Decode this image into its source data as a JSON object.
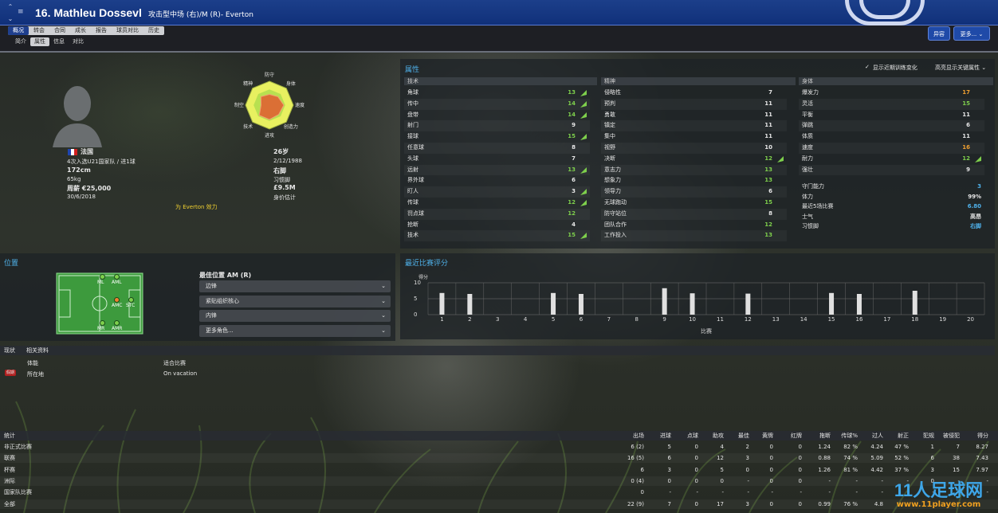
{
  "header": {
    "title": "16. Mathleu Dossevl",
    "role": "攻击型中场 (右)/M (R)- Everton",
    "nav_up": "⌃",
    "nav_down": "⌄",
    "menu_icon": "≡",
    "btn_offer": "异容",
    "btn_more": "更多..."
  },
  "tabs": [
    "概况",
    "转会",
    "合同",
    "成长",
    "报告",
    "球员对比",
    "历史"
  ],
  "subtabs": [
    "简介",
    "属性",
    "信息",
    "对比"
  ],
  "profile": {
    "nationality": "法国",
    "caps": "4次入选U21国家队 / 进1球",
    "height": "172cm",
    "weight": "65kg",
    "wage": "周薪 €25,000",
    "contract": "30/6/2018",
    "age": "26岁",
    "dob": "2/12/1988",
    "foot_val": "右脚",
    "foot_label": "习惯脚",
    "value": "£9.5M",
    "value_label": "身价估计",
    "club_note": "为 Everton 效力"
  },
  "radar": {
    "labels": [
      "防守",
      "身体",
      "速度",
      "创造力",
      "进攻",
      "技术",
      "制空",
      "精神"
    ],
    "values": [
      0.45,
      0.5,
      0.6,
      0.55,
      0.6,
      0.6,
      0.35,
      0.5
    ]
  },
  "attributes": {
    "title": "属性",
    "show_changes": "显示近期训练变化",
    "highlight": "高亮显示关键属性",
    "technical": {
      "title": "技术",
      "items": [
        {
          "n": "角球",
          "v": "13",
          "c": "g",
          "a": "up"
        },
        {
          "n": "传中",
          "v": "14",
          "c": "g",
          "a": "up"
        },
        {
          "n": "盘带",
          "v": "14",
          "c": "g",
          "a": "up"
        },
        {
          "n": "射门",
          "v": "9",
          "c": "w",
          "a": ""
        },
        {
          "n": "接球",
          "v": "15",
          "c": "g",
          "a": "up"
        },
        {
          "n": "任意球",
          "v": "8",
          "c": "w",
          "a": ""
        },
        {
          "n": "头球",
          "v": "7",
          "c": "w",
          "a": ""
        },
        {
          "n": "远射",
          "v": "13",
          "c": "g",
          "a": "up"
        },
        {
          "n": "界外球",
          "v": "6",
          "c": "w",
          "a": ""
        },
        {
          "n": "盯人",
          "v": "3",
          "c": "w",
          "a": "up"
        },
        {
          "n": "传球",
          "v": "12",
          "c": "g",
          "a": "up"
        },
        {
          "n": "罚点球",
          "v": "12",
          "c": "g",
          "a": ""
        },
        {
          "n": "抢断",
          "v": "4",
          "c": "w",
          "a": ""
        },
        {
          "n": "技术",
          "v": "15",
          "c": "g",
          "a": "up"
        }
      ]
    },
    "mental": {
      "title": "精神",
      "items": [
        {
          "n": "侵略性",
          "v": "7",
          "c": "w",
          "a": ""
        },
        {
          "n": "预判",
          "v": "11",
          "c": "w",
          "a": ""
        },
        {
          "n": "勇敢",
          "v": "11",
          "c": "w",
          "a": ""
        },
        {
          "n": "镇定",
          "v": "11",
          "c": "w",
          "a": ""
        },
        {
          "n": "集中",
          "v": "11",
          "c": "w",
          "a": ""
        },
        {
          "n": "视野",
          "v": "10",
          "c": "w",
          "a": ""
        },
        {
          "n": "决断",
          "v": "12",
          "c": "g",
          "a": "up"
        },
        {
          "n": "意志力",
          "v": "13",
          "c": "g",
          "a": ""
        },
        {
          "n": "想象力",
          "v": "13",
          "c": "g",
          "a": ""
        },
        {
          "n": "领导力",
          "v": "6",
          "c": "w",
          "a": ""
        },
        {
          "n": "无球跑动",
          "v": "15",
          "c": "g",
          "a": ""
        },
        {
          "n": "防守站位",
          "v": "8",
          "c": "w",
          "a": ""
        },
        {
          "n": "团队合作",
          "v": "12",
          "c": "g",
          "a": ""
        },
        {
          "n": "工作投入",
          "v": "13",
          "c": "g",
          "a": ""
        }
      ]
    },
    "physical": {
      "title": "身体",
      "items": [
        {
          "n": "爆发力",
          "v": "17",
          "c": "o",
          "a": ""
        },
        {
          "n": "灵活",
          "v": "15",
          "c": "g",
          "a": ""
        },
        {
          "n": "平衡",
          "v": "11",
          "c": "w",
          "a": ""
        },
        {
          "n": "弹跳",
          "v": "6",
          "c": "w",
          "a": ""
        },
        {
          "n": "体质",
          "v": "11",
          "c": "w",
          "a": ""
        },
        {
          "n": "速度",
          "v": "16",
          "c": "o",
          "a": ""
        },
        {
          "n": "耐力",
          "v": "12",
          "c": "g",
          "a": "up"
        },
        {
          "n": "强壮",
          "v": "9",
          "c": "w",
          "a": ""
        }
      ]
    },
    "extra": [
      {
        "n": "守门能力",
        "v": "3",
        "c": "b"
      },
      {
        "n": "体力",
        "v": "99%",
        "c": "w"
      },
      {
        "n": "最近5场比赛",
        "v": "6.80",
        "c": "b"
      },
      {
        "n": "士气",
        "v": "高昂",
        "c": "w"
      },
      {
        "n": "习惯脚",
        "v": "右脚",
        "c": "b"
      }
    ]
  },
  "positions": {
    "title": "位置",
    "best_label": "最佳位置 AM (R)",
    "dropdowns": [
      "边锋",
      "紧贴组织核心",
      "内锋",
      "更多角色..."
    ],
    "pitch_labels": [
      "ML",
      "AML",
      "AMC",
      "STC",
      "MR",
      "AMR"
    ]
  },
  "chart_data": {
    "type": "bar",
    "title": "最近比赛评分",
    "ylabel": "得分",
    "xlabel": "比赛",
    "ylim": [
      0,
      10
    ],
    "yticks": [
      0,
      5,
      10
    ],
    "categories": [
      "1",
      "2",
      "3",
      "4",
      "5",
      "6",
      "7",
      "8",
      "9",
      "10",
      "11",
      "12",
      "13",
      "14",
      "15",
      "16",
      "17",
      "18",
      "19",
      "20"
    ],
    "values": [
      6.8,
      6.5,
      null,
      null,
      6.8,
      6.5,
      null,
      null,
      8.3,
      6.7,
      null,
      6.6,
      null,
      null,
      6.8,
      6.5,
      null,
      7.5,
      null,
      null
    ]
  },
  "status": {
    "tabs": [
      "现状",
      "相关资料"
    ],
    "fit_label": "体能",
    "location_label": "所在地",
    "match_label": "适合比赛",
    "location_value": "On vacation",
    "badge": "假期"
  },
  "stats": {
    "title": "统计",
    "headers": [
      "出场",
      "进球",
      "点球",
      "助攻",
      "最佳",
      "黄牌",
      "红牌",
      "拖断",
      "传球%",
      "过人",
      "射正",
      "犯规",
      "被侵犯",
      "得分"
    ],
    "rows": [
      {
        "label": "非正式比赛",
        "vals": [
          "6 (2)",
          "5",
          "0",
          "4",
          "2",
          "0",
          "0",
          "1.24",
          "82 %",
          "4.24",
          "47 %",
          "1",
          "7",
          "8.27"
        ]
      },
      {
        "label": "联赛",
        "vals": [
          "16 (5)",
          "6",
          "0",
          "12",
          "3",
          "0",
          "0",
          "0.88",
          "74 %",
          "5.09",
          "52 %",
          "6",
          "38",
          "7.43"
        ]
      },
      {
        "label": "杯赛",
        "vals": [
          "6",
          "3",
          "0",
          "5",
          "0",
          "0",
          "0",
          "1.26",
          "81 %",
          "4.42",
          "37 %",
          "3",
          "15",
          "7.97"
        ]
      },
      {
        "label": "洲际",
        "vals": [
          "0 (4)",
          "0",
          "0",
          "0",
          "-",
          "0",
          "0",
          "-",
          "-",
          "-",
          "-",
          "0",
          "-",
          "-"
        ]
      },
      {
        "label": "国家队比赛",
        "vals": [
          "0",
          "-",
          "-",
          "-",
          "-",
          "-",
          "-",
          "-",
          "-",
          "-",
          "-",
          "-",
          "-",
          "-"
        ]
      },
      {
        "label": "全部",
        "vals": [
          "22 (9)",
          "7",
          "0",
          "17",
          "3",
          "0",
          "0",
          "0.99",
          "76 %",
          "4.8",
          "",
          "",
          "",
          ""
        ]
      }
    ]
  },
  "watermark": {
    "text": "11人足球网",
    "url": "www.11player.com"
  }
}
